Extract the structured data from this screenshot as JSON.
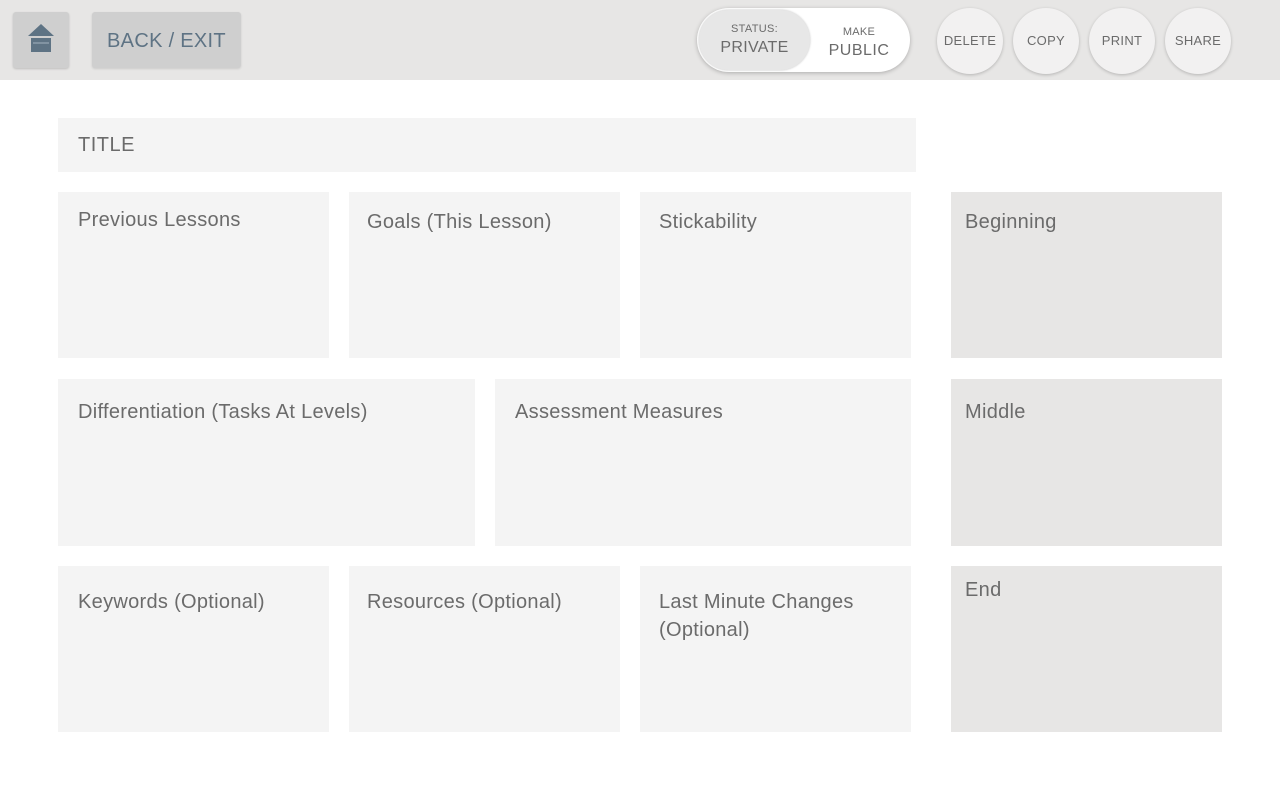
{
  "toolbar": {
    "back_label": "BACK / EXIT",
    "status_caption": "STATUS:",
    "status_value": "PRIVATE",
    "make_caption": "MAKE",
    "make_value": "PUBLIC",
    "delete_label": "DELETE",
    "copy_label": "COPY",
    "print_label": "PRINT",
    "share_label": "SHARE"
  },
  "lesson": {
    "title_placeholder": "TITLE",
    "previous_lessons": "Previous Lessons",
    "goals": "Goals (This Lesson)",
    "stickability": "Stickability",
    "differentiation": "Differentiation (Tasks At Levels)",
    "assessment": "Assessment Measures",
    "keywords": "Keywords (Optional)",
    "resources": "Resources (Optional)",
    "last_minute_line1": "Last Minute Changes",
    "last_minute_line2": "(Optional)"
  },
  "phases": {
    "beginning": "Beginning",
    "middle": "Middle",
    "end": "End"
  },
  "icons": {
    "home": "home-icon"
  },
  "colors": {
    "topbar": "#e7e6e5",
    "button": "#cfcfcf",
    "accent_text": "#5e7384",
    "card": "#f4f4f4",
    "phase_card": "#e7e6e5"
  }
}
